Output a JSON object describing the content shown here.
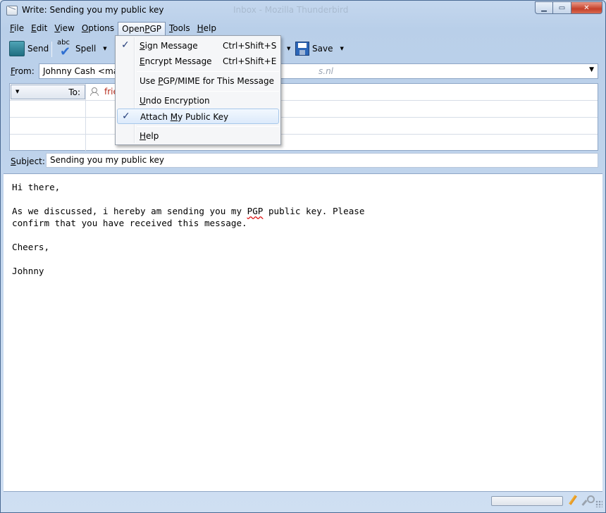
{
  "window": {
    "title": "Write: Sending you my public key",
    "title_ghost": "Inbox - Mozilla Thunderbird",
    "minimize_glyph": "▁",
    "maximize_glyph": "▭",
    "close_glyph": "✕"
  },
  "menubar": {
    "items": [
      {
        "pre": "",
        "ul": "F",
        "post": "ile"
      },
      {
        "pre": "",
        "ul": "E",
        "post": "dit"
      },
      {
        "pre": "",
        "ul": "V",
        "post": "iew"
      },
      {
        "pre": "",
        "ul": "O",
        "post": "ptions"
      },
      {
        "pre": "Open",
        "ul": "P",
        "post": "GP"
      },
      {
        "pre": "",
        "ul": "T",
        "post": "ools"
      },
      {
        "pre": "",
        "ul": "H",
        "post": "elp"
      }
    ]
  },
  "toolbar": {
    "send_label": "Send",
    "spell_label": "Spell",
    "spell_icon_text": "abc",
    "save_label": "Save"
  },
  "header": {
    "from_label_ul": "F",
    "from_label_rest": "rom:",
    "from_value": "Johnny Cash <mail",
    "from_ghost": "s.nl",
    "to_label": "To:",
    "to_value": "frie",
    "subject_label_ul": "S",
    "subject_label_rest": "ubject:",
    "subject_value": "Sending you my public key"
  },
  "openpgp_menu": {
    "sign": {
      "ul": "S",
      "rest": "ign Message",
      "shortcut": "Ctrl+Shift+S",
      "checked": "✓"
    },
    "encrypt": {
      "ul": "E",
      "rest": "ncrypt Message",
      "shortcut": "Ctrl+Shift+E"
    },
    "pgpmime": {
      "pre": "Use ",
      "ul": "P",
      "rest": "GP/MIME for This Message"
    },
    "undo": {
      "ul": "U",
      "rest": "ndo Encryption"
    },
    "attach": {
      "pre": "Attach ",
      "ul": "M",
      "rest": "y Public Key",
      "checked": "✓"
    },
    "help": {
      "ul": "H",
      "rest": "elp"
    }
  },
  "body": {
    "line1": "Hi there,",
    "line2_pre": "As we discussed, i hereby am sending you my ",
    "line2_err": "PGP",
    "line2_post": " public key. Please",
    "line3": "confirm that you have received this message.",
    "line4": "Cheers,",
    "line5": "Johnny"
  }
}
